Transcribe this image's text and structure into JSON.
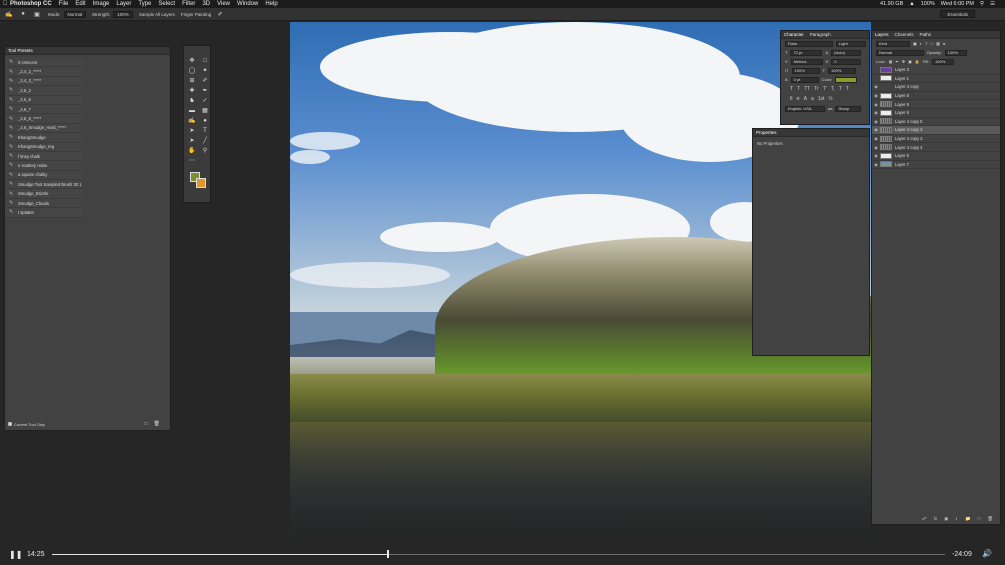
{
  "menubar": {
    "app": "Photoshop CC",
    "items": [
      "File",
      "Edit",
      "Image",
      "Layer",
      "Type",
      "Select",
      "Filter",
      "3D",
      "View",
      "Window",
      "Help"
    ],
    "status": {
      "storage": "41.90 GB",
      "battery": "100%",
      "clock": "Wed 6:00 PM"
    }
  },
  "options": {
    "mode_label": "Mode:",
    "mode_value": "Normal",
    "strength_label": "Strength:",
    "strength_value": "100%",
    "sample_all": "Sample All Layers",
    "finger": "Finger Painting",
    "workspace": "Essentials"
  },
  "presets": {
    "title": "Tool Presets",
    "items": [
      "0 crescent",
      "_2,4_2_*****",
      "_2,4_3_*****",
      "_2,5_2",
      "_2,5_6",
      "_2,6_7",
      "_2,6_8_*****",
      "_2,6_Smudge_Hard_*****",
      "KhangSmudge",
      "KhangSmudge_reg",
      "f tinsy chalk",
      "n scattery noise",
      "a square chalky",
      "Smudge Tool Sampled Brush 30 1",
      "Smudge_Brizzle",
      "Smudge_Clouds",
      "t splatter"
    ],
    "current_only": "Current Tool Only"
  },
  "character": {
    "tabs": [
      "Character",
      "Paragraph"
    ],
    "font": "Fiata",
    "style": "Light",
    "size": "72 pt",
    "leading": "(Auto)",
    "kerning": "Metrics",
    "tracking": "0",
    "vscale": "100%",
    "hscale": "100%",
    "baseline": "0 pt",
    "color_label": "Color:",
    "language": "English: USA",
    "aa": "Sharp",
    "styles": [
      "T",
      "T",
      "TT",
      "Tr",
      "T'",
      "T,",
      "T",
      "T"
    ]
  },
  "properties": {
    "title": "Properties",
    "body": "No Properties"
  },
  "layers": {
    "tabs": [
      "Layers",
      "Channels",
      "Paths"
    ],
    "kind": "Kind",
    "blend": "Normal",
    "opacity_label": "Opacity:",
    "opacity": "100%",
    "lock_label": "Lock:",
    "fill_label": "Fill:",
    "fill": "100%",
    "rows": [
      {
        "name": "Layer 3",
        "thumb": "purple",
        "vis": false,
        "sel": false
      },
      {
        "name": "Layer 1",
        "thumb": "white",
        "vis": false,
        "sel": false
      },
      {
        "name": "Layer 4 copy",
        "thumb": "blank",
        "vis": true,
        "sel": false
      },
      {
        "name": "Layer 8",
        "thumb": "white",
        "vis": true,
        "sel": false
      },
      {
        "name": "Layer 9",
        "thumb": "dots",
        "vis": true,
        "sel": false
      },
      {
        "name": "Layer 6",
        "thumb": "white",
        "vis": true,
        "sel": false
      },
      {
        "name": "Layer 4 copy 5",
        "thumb": "dots",
        "vis": true,
        "sel": false
      },
      {
        "name": "Layer 4 copy 2",
        "thumb": "dots",
        "vis": true,
        "sel": true
      },
      {
        "name": "Layer 4 copy 3",
        "thumb": "dots",
        "vis": true,
        "sel": false
      },
      {
        "name": "Layer 4 copy 4",
        "thumb": "dots",
        "vis": true,
        "sel": false
      },
      {
        "name": "Layer 5",
        "thumb": "white",
        "vis": true,
        "sel": false
      },
      {
        "name": "Layer 7",
        "thumb": "img",
        "vis": true,
        "sel": false
      }
    ]
  },
  "player": {
    "current": "14:25",
    "remaining": "-24:09",
    "progress": 0.376
  }
}
